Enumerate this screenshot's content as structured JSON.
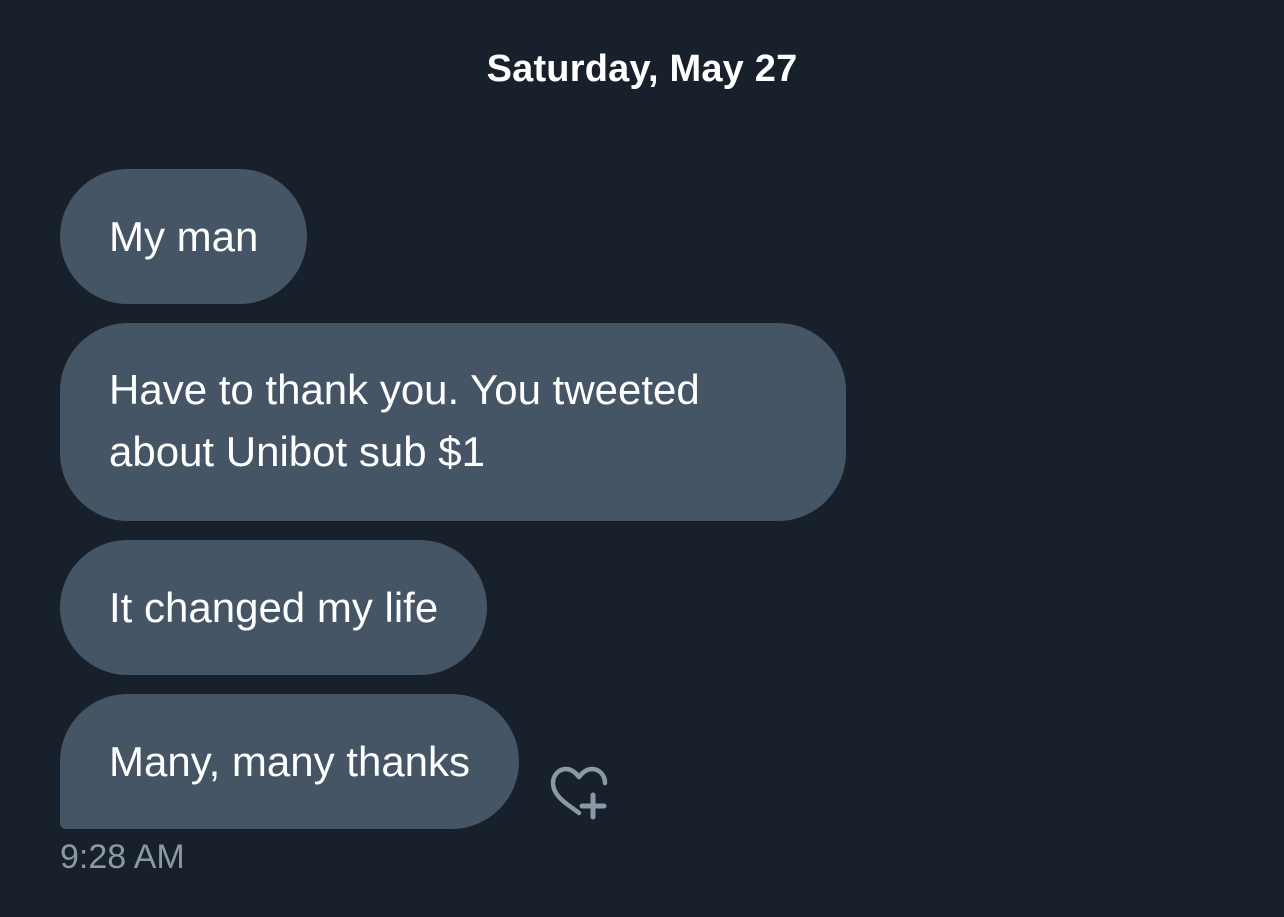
{
  "conversation": {
    "date_divider": "Saturday, May 27",
    "messages": [
      {
        "text": "My man"
      },
      {
        "text": "Have to thank you. You tweeted about Unibot sub $1"
      },
      {
        "text": "It changed my life"
      },
      {
        "text": "Many, many thanks"
      }
    ],
    "last_message_time": "9:28 AM",
    "react_icon": "heart-plus-icon"
  },
  "colors": {
    "background": "#18202b",
    "bubble": "#465565",
    "text": "#ffffff",
    "muted_text": "#8b98a5",
    "icon": "#8b98a5"
  }
}
